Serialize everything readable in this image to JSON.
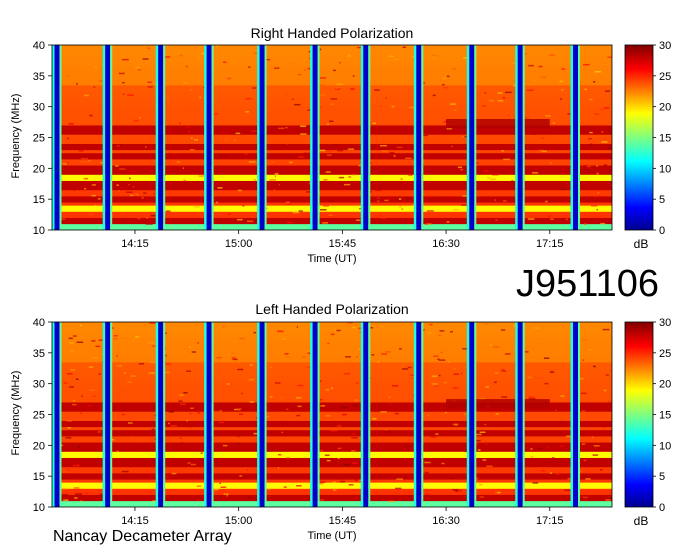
{
  "figure_id": "J951106",
  "instrument": "Nancay Decameter Array",
  "colorbar": {
    "unit": "dB",
    "ticks": [
      0,
      5,
      10,
      15,
      20,
      25,
      30
    ],
    "range": [
      0,
      30
    ]
  },
  "chart_data": [
    {
      "type": "heatmap",
      "title": "Right Handed Polarization",
      "xlabel": "Time (UT)",
      "ylabel": "Frequency (MHz)",
      "x_tick_labels": [
        "14:15",
        "15:00",
        "15:45",
        "16:30",
        "17:15"
      ],
      "x_ticks_minutes": [
        855,
        900,
        945,
        990,
        1035
      ],
      "xlim_minutes": [
        819,
        1062
      ],
      "y_ticks": [
        10,
        15,
        20,
        25,
        30,
        35,
        40
      ],
      "ylim": [
        10,
        40
      ],
      "zlim": [
        0,
        30
      ],
      "calibration_gaps_minutes": [
        819,
        841,
        864,
        885,
        908,
        931,
        953,
        976,
        999,
        1020,
        1044
      ],
      "dark_bands_mhz": [
        [
          11.3,
          11.8
        ],
        [
          14.5,
          15.2
        ],
        [
          16.6,
          17.6
        ],
        [
          19.0,
          20.5
        ],
        [
          21.5,
          22.3
        ],
        [
          23.0,
          24.0
        ],
        [
          25.5,
          27.0
        ]
      ],
      "light_bands_mhz": [
        [
          10.0,
          11.0
        ],
        [
          13.0,
          13.6
        ],
        [
          18.0,
          18.6
        ]
      ],
      "enhanced_emission": {
        "time_minutes": [
          990,
          1035
        ],
        "freq_mhz": [
          26.5,
          28.0
        ]
      }
    },
    {
      "type": "heatmap",
      "title": "Left Handed Polarization",
      "xlabel": "Time (UT)",
      "ylabel": "Frequency (MHz)",
      "x_tick_labels": [
        "14:15",
        "15:00",
        "15:45",
        "16:30",
        "17:15"
      ],
      "x_ticks_minutes": [
        855,
        900,
        945,
        990,
        1035
      ],
      "xlim_minutes": [
        819,
        1062
      ],
      "y_ticks": [
        10,
        15,
        20,
        25,
        30,
        35,
        40
      ],
      "ylim": [
        10,
        40
      ],
      "zlim": [
        0,
        30
      ],
      "calibration_gaps_minutes": [
        819,
        841,
        864,
        885,
        908,
        931,
        953,
        976,
        999,
        1020,
        1044
      ],
      "dark_bands_mhz": [
        [
          11.3,
          11.8
        ],
        [
          14.5,
          15.2
        ],
        [
          16.6,
          17.6
        ],
        [
          19.0,
          20.5
        ],
        [
          21.5,
          22.3
        ],
        [
          23.0,
          24.0
        ],
        [
          25.5,
          27.0
        ]
      ],
      "light_bands_mhz": [
        [
          10.0,
          11.0
        ],
        [
          13.0,
          13.6
        ],
        [
          18.0,
          18.6
        ]
      ],
      "enhanced_emission": {
        "time_minutes": [
          990,
          1035
        ],
        "freq_mhz": [
          26.0,
          27.5
        ]
      }
    }
  ]
}
